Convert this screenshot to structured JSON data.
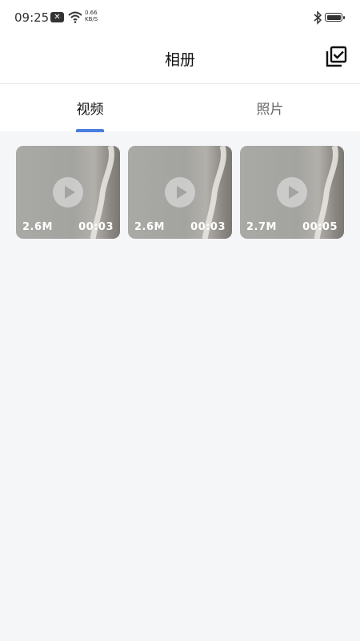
{
  "status_bar": {
    "time": "09:25",
    "speed_value": "0.66",
    "speed_unit": "KB/S"
  },
  "header": {
    "title": "相册",
    "select_icon": "multi-select-icon"
  },
  "tabs": [
    {
      "label": "视频",
      "active": true
    },
    {
      "label": "照片",
      "active": false
    }
  ],
  "videos": [
    {
      "size": "2.6M",
      "duration": "00:03"
    },
    {
      "size": "2.6M",
      "duration": "00:03"
    },
    {
      "size": "2.7M",
      "duration": "00:05"
    }
  ],
  "colors": {
    "accent": "#4a7ee0",
    "background": "#f5f6f8"
  }
}
